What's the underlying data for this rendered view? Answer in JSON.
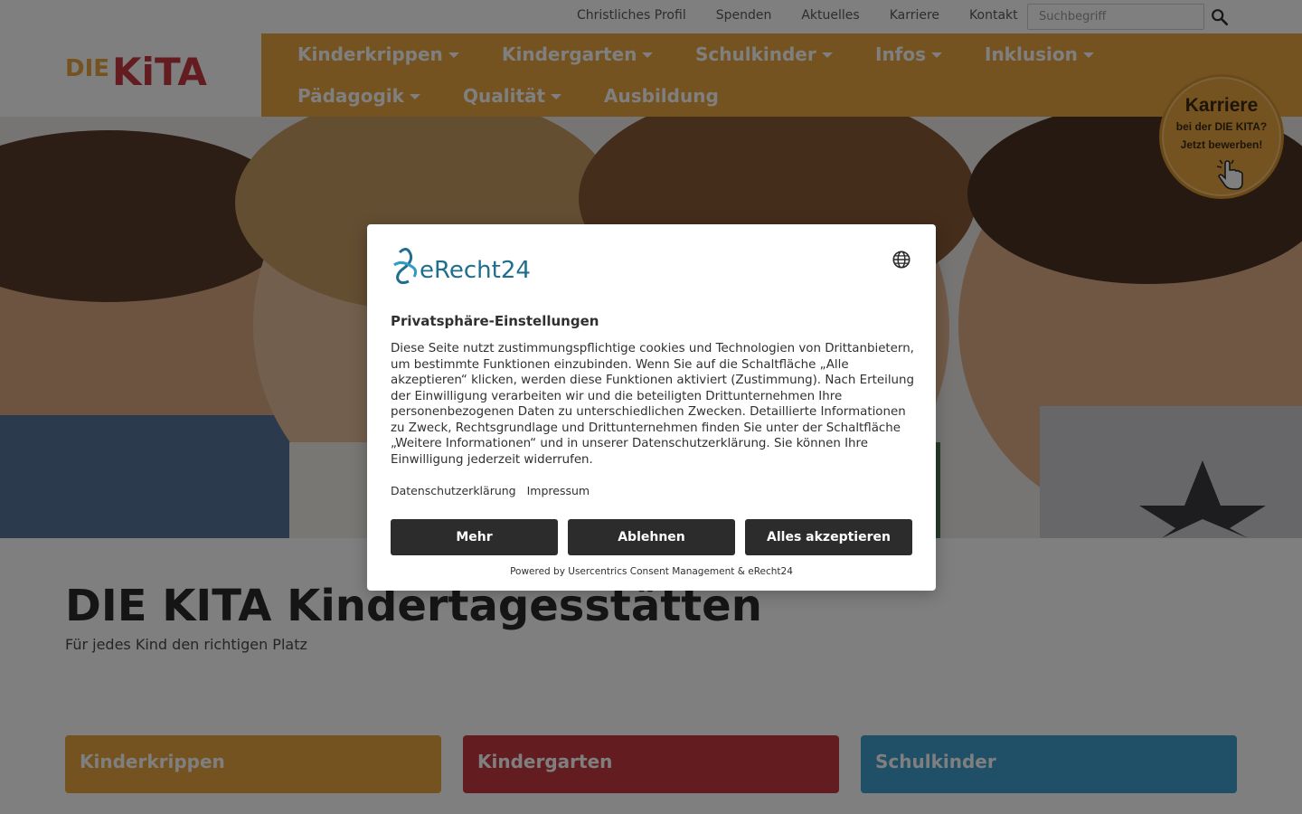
{
  "topbar": {
    "links": [
      "Christliches Profil",
      "Spenden",
      "Aktuelles",
      "Karriere",
      "Kontakt"
    ],
    "search_placeholder": "Suchbegriff"
  },
  "logo": {
    "text_die": "DIE",
    "text_kita": "KiTA"
  },
  "nav": {
    "row1": [
      "Kinderkrippen",
      "Kindergarten",
      "Schulkinder",
      "Infos",
      "Inklusion"
    ],
    "row2": [
      "Pädagogik",
      "Qualität",
      "Ausbildung"
    ]
  },
  "badge": {
    "line1": "Karriere",
    "line2": "bei der DIE KITA?",
    "line3": "Jetzt bewerben!"
  },
  "main": {
    "title": "DIE KITA Kindertagesstätten",
    "subtitle": "Für jedes Kind den richtigen Platz",
    "cards": [
      "Kinderkrippen",
      "Kindergarten",
      "Schulkinder"
    ]
  },
  "consent": {
    "brand": "eRecht24",
    "title": "Privatsphäre-Einstellungen",
    "text": "Diese Seite nutzt zustimmungspflichtige cookies und Technologien von Drittanbietern, um bestimmte Funktionen einzubinden. Wenn Sie auf die Schaltfläche „Alle akzeptieren“ klicken, werden diese Funktionen aktiviert (Zustimmung). Nach Erteilung der Einwilligung verarbeiten wir und die beteiligten Drittunternehmen Ihre personenbezogenen Daten zu unterschiedlichen Zwecken. Detaillierte Informationen zu Zweck, Rechtsgrundlage und Drittunternehmen finden Sie unter der Schaltfläche „Weitere Informationen“ und in unserer Datenschutzerklärung. Sie können Ihre Einwilligung jederzeit widerrufen.",
    "link_privacy": "Datenschutzerklärung",
    "link_imprint": "Impressum",
    "btn_more": "Mehr",
    "btn_deny": "Ablehnen",
    "btn_accept": "Alles akzeptieren",
    "powered": "Powered by Usercentrics Consent Management & eRecht24"
  },
  "colors": {
    "nav_orange": "#e8a640",
    "card_red": "#c63a42",
    "card_blue": "#3fa0cf",
    "button_dark": "#2c2c2c",
    "brand_teal": "#1e6f8e"
  }
}
